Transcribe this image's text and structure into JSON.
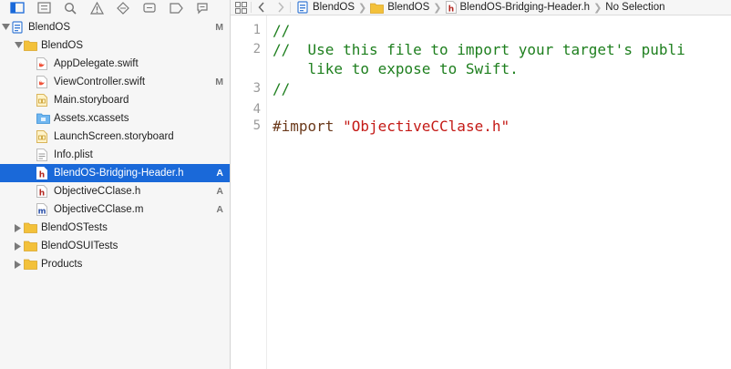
{
  "colors": {
    "selection": "#1a69d9",
    "comment": "#1e7f1e",
    "preprocessor": "#6b3a1c",
    "string": "#c41a16",
    "folder": "#f3c13a",
    "navigator_bg": "#f6f6f6"
  },
  "navigator": {
    "toolbar_icons": [
      "project-navigator-icon",
      "symbol-navigator-icon",
      "find-navigator-icon",
      "issue-navigator-icon",
      "test-navigator-icon",
      "debug-navigator-icon",
      "breakpoint-navigator-icon",
      "report-navigator-icon"
    ],
    "items": [
      {
        "label": "BlendOS",
        "badge": "M",
        "icon": "project-icon",
        "disclosure": "open"
      },
      {
        "label": "BlendOS",
        "badge": "",
        "icon": "folder-icon",
        "disclosure": "open"
      },
      {
        "label": "AppDelegate.swift",
        "badge": "",
        "icon": "swift-file-icon",
        "disclosure": ""
      },
      {
        "label": "ViewController.swift",
        "badge": "M",
        "icon": "swift-file-icon",
        "disclosure": ""
      },
      {
        "label": "Main.storyboard",
        "badge": "",
        "icon": "storyboard-file-icon",
        "disclosure": ""
      },
      {
        "label": "Assets.xcassets",
        "badge": "",
        "icon": "asset-catalog-icon",
        "disclosure": ""
      },
      {
        "label": "LaunchScreen.storyboard",
        "badge": "",
        "icon": "storyboard-file-icon",
        "disclosure": ""
      },
      {
        "label": "Info.plist",
        "badge": "",
        "icon": "plist-file-icon",
        "disclosure": ""
      },
      {
        "label": "BlendOS-Bridging-Header.h",
        "badge": "A",
        "icon": "header-file-icon",
        "disclosure": "",
        "selected": true
      },
      {
        "label": "ObjectiveCClase.h",
        "badge": "A",
        "icon": "header-file-icon",
        "disclosure": ""
      },
      {
        "label": "ObjectiveCClase.m",
        "badge": "A",
        "icon": "implementation-file-icon",
        "disclosure": ""
      },
      {
        "label": "BlendOSTests",
        "badge": "",
        "icon": "folder-icon",
        "disclosure": "closed"
      },
      {
        "label": "BlendOSUITests",
        "badge": "",
        "icon": "folder-icon",
        "disclosure": "closed"
      },
      {
        "label": "Products",
        "badge": "",
        "icon": "folder-icon",
        "disclosure": "closed"
      }
    ]
  },
  "jumpbar": {
    "crumbs": [
      {
        "label": "BlendOS",
        "icon": "project-icon"
      },
      {
        "label": "BlendOS",
        "icon": "folder-icon"
      },
      {
        "label": "BlendOS-Bridging-Header.h",
        "icon": "header-file-icon"
      },
      {
        "label": "No Selection",
        "icon": ""
      }
    ]
  },
  "editor": {
    "lines": [
      {
        "number": "1",
        "text": "//"
      },
      {
        "number": "2",
        "text": "//  Use this file to import your target's publi"
      },
      {
        "number": "",
        "text": "    like to expose to Swift."
      },
      {
        "number": "3",
        "text": "//"
      },
      {
        "number": "4",
        "text": ""
      },
      {
        "number": "5",
        "directive": "#import",
        "string": "\"ObjectiveCClase.h\""
      }
    ]
  }
}
